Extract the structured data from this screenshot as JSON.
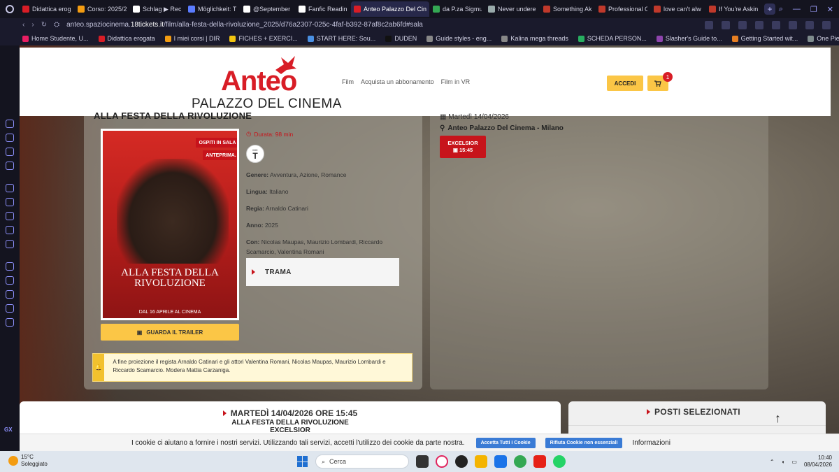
{
  "browser": {
    "tabs": [
      {
        "label": "Didattica erogata",
        "color": "#d81d26"
      },
      {
        "label": "Corso: 2025/2",
        "color": "#f39c12"
      },
      {
        "label": "Schlag ▶ Rec",
        "color": "#ffffff"
      },
      {
        "label": "Möglichkeit: T",
        "color": "#5b7cff"
      },
      {
        "label": "@September",
        "color": "#ffffff"
      },
      {
        "label": "Fanfic Readin",
        "color": "#ffffff"
      },
      {
        "label": "Anteo Palazzo Del Cinem",
        "color": "#d81d26",
        "active": true
      },
      {
        "label": "da P.za Sigmu",
        "color": "#34a853"
      },
      {
        "label": "Never undere",
        "color": "#9aa"
      },
      {
        "label": "Something Ak",
        "color": "#c0392b"
      },
      {
        "label": "Professional C",
        "color": "#c0392b"
      },
      {
        "label": "love can't alw",
        "color": "#c0392b"
      },
      {
        "label": "If You're Askin",
        "color": "#c0392b"
      }
    ],
    "new_tab_label": "+",
    "url_prefix": "anteo.spaziocinema.",
    "url_domain": "18tickets.it",
    "url_path": "/film/alla-festa-della-rivoluzione_2025/d76a2307-025c-4faf-b392-87af8c2ab6fd#sala",
    "bookmarks": [
      {
        "label": "Home Studente, U...",
        "color": "#e91e63"
      },
      {
        "label": "Didattica erogata",
        "color": "#d81d26"
      },
      {
        "label": "I miei corsi | DIR",
        "color": "#f39c12"
      },
      {
        "label": "FICHES + EXERCI...",
        "color": "#f1c40f"
      },
      {
        "label": "START HERE: Sou...",
        "color": "#4a90e2"
      },
      {
        "label": "DUDEN",
        "color": "#111111"
      },
      {
        "label": "Guide styles - eng...",
        "color": "#888888"
      },
      {
        "label": "Kalina mega threads",
        "color": "#888888"
      },
      {
        "label": "SCHEDA PERSON...",
        "color": "#27ae60"
      },
      {
        "label": "Slasher's Guide to...",
        "color": "#8e44ad"
      },
      {
        "label": "Getting Started wit...",
        "color": "#e67e22"
      },
      {
        "label": "One Piece timeline",
        "color": "#7f8c8d"
      }
    ],
    "sidebar_label": "GX"
  },
  "site": {
    "logo_word": "Anteo",
    "logo_sub": "PALAZZO DEL CINEMA",
    "nav": [
      "Film",
      "Acquista un abbonamento",
      "Film in VR"
    ],
    "login_label": "ACCEDI",
    "cart_count": "1",
    "brand_red": "#d81d26",
    "brand_yellow": "#fbc646"
  },
  "film": {
    "title": "ALLA FESTA DELLA RIVOLUZIONE",
    "poster_title_1": "ALLA FESTA DELLA",
    "poster_title_2": "RIVOLUZIONE",
    "poster_date": "DAL 16 APRILE AL CINEMA",
    "poster_ribbon_1": "OSPITI IN SALA",
    "poster_ribbon_2": "ANTEPRIMA.",
    "duration": "Durata: 98 min",
    "age_letter": "T",
    "age_top": "MIC",
    "rows": [
      {
        "label": "Genere:",
        "value": "Avventura, Azione, Romance"
      },
      {
        "label": "Lingua:",
        "value": "Italiano"
      },
      {
        "label": "Regia:",
        "value": "Arnaldo Catinari"
      },
      {
        "label": "Anno:",
        "value": "2025"
      },
      {
        "label": "Con:",
        "value": "Nicolas Maupas, Maurizio Lombardi, Riccardo Scamarcio, Valentina Romani"
      }
    ],
    "trailer_label": "GUARDA IL TRAILER",
    "trama_label": "TRAMA",
    "note": "A fine proiezione il regista Arnaldo Catinari e gli attori Valentina Romani, Nicolas Maupas, Maurizio Lombardi e Riccardo Scamarcio. Modera Mattia Carzaniga."
  },
  "show": {
    "date": "Martedì 14/04/2026",
    "place": "Anteo Palazzo Del Cinema - Milano",
    "hall": "EXCELSIOR",
    "time": "15:45"
  },
  "summary": {
    "line1": "MARTEDÌ 14/04/2026 ORE 15:45",
    "line2": "ALLA FESTA DELLA RIVOLUZIONE",
    "line3": "EXCELSIOR"
  },
  "posti": {
    "title": "POSTI SELEZIONATI"
  },
  "cookie": {
    "message": "I cookie ci aiutano a fornire i nostri servizi. Utilizzando tali servizi, accetti l'utilizzo dei cookie da parte nostra.",
    "accept_label": "Accetta Tutti i Cookie",
    "reject_label": "Rifiuta Cookie non essenziali",
    "info_label": "Informazioni"
  },
  "taskbar": {
    "temp": "15°C",
    "weather": "Soleggiato",
    "weather_badge": "3",
    "search_label": "Cerca",
    "time": "10:40",
    "date": "08/04/2026",
    "whatsapp_badge": "4"
  }
}
